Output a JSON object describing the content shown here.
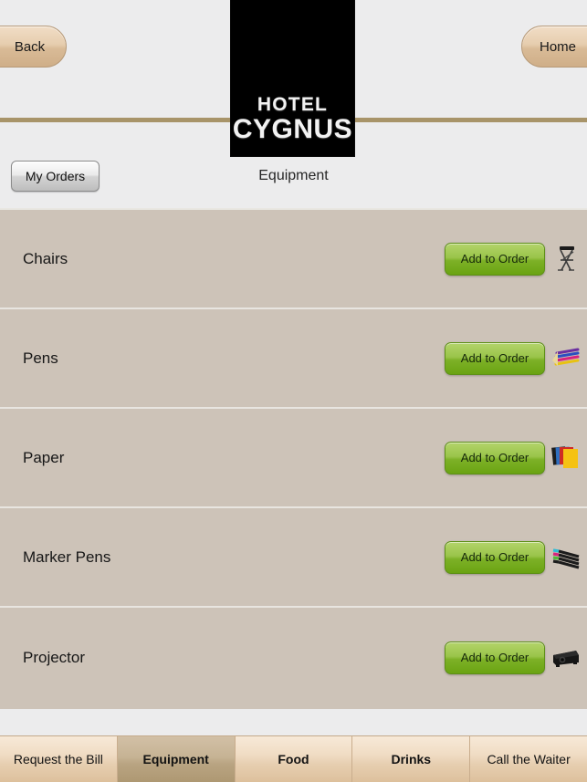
{
  "header": {
    "back_label": "Back",
    "home_label": "Home",
    "logo_line1": "HOTEL",
    "logo_line2": "CYGNUS",
    "my_orders_label": "My Orders",
    "page_title": "Equipment",
    "rule_color": "#a89469"
  },
  "list": {
    "add_label": "Add to Order",
    "items": [
      {
        "name": "Chairs",
        "icon": "folding-chair-icon"
      },
      {
        "name": "Pens",
        "icon": "colored-pens-icon"
      },
      {
        "name": "Paper",
        "icon": "paper-stack-icon"
      },
      {
        "name": "Marker Pens",
        "icon": "marker-pens-icon"
      },
      {
        "name": "Projector",
        "icon": "projector-icon"
      }
    ]
  },
  "tabbar": {
    "tabs": [
      {
        "label": "Request the Bill",
        "active": false,
        "bold": false
      },
      {
        "label": "Equipment",
        "active": true,
        "bold": true
      },
      {
        "label": "Food",
        "active": false,
        "bold": true
      },
      {
        "label": "Drinks",
        "active": false,
        "bold": true
      },
      {
        "label": "Call the Waiter",
        "active": false,
        "bold": false
      }
    ]
  },
  "colors": {
    "row_bg": "#cdc3b8",
    "page_bg": "#ececed",
    "accent_green": "#7db127",
    "accent_tan": "#e6cdae"
  }
}
